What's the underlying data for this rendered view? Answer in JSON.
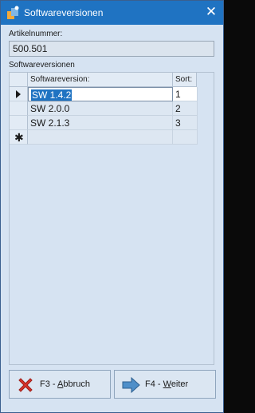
{
  "window": {
    "title": "Softwareversionen",
    "close_glyph": "✕",
    "titlebar_color": "#1f73c2"
  },
  "article": {
    "label": "Artikelnummer:",
    "value": "500.501"
  },
  "versions": {
    "section_label": "Softwareversionen",
    "columns": [
      "Softwareversion:",
      "Sort:"
    ],
    "rows": [
      {
        "version": "SW 1.4.2",
        "sort": "1"
      },
      {
        "version": "SW 2.0.0",
        "sort": "2"
      },
      {
        "version": "SW 2.1.3",
        "sort": "3"
      }
    ],
    "selected_indicator_icon": "current-row-arrow-icon",
    "new_row_icon": "new-row-asterisk-icon"
  },
  "buttons": {
    "cancel": {
      "prefix": "F3 - ",
      "accel": "A",
      "rest": "bbruch",
      "icon": "red-x-icon"
    },
    "next": {
      "prefix": "F4 - ",
      "accel": "W",
      "rest": "eiter",
      "icon": "blue-arrow-right-icon"
    }
  },
  "colors": {
    "accent": "#1f73c2",
    "background": "#d6e3f2",
    "cancel_icon": "#d9342b",
    "next_icon": "#4f8fc9"
  }
}
